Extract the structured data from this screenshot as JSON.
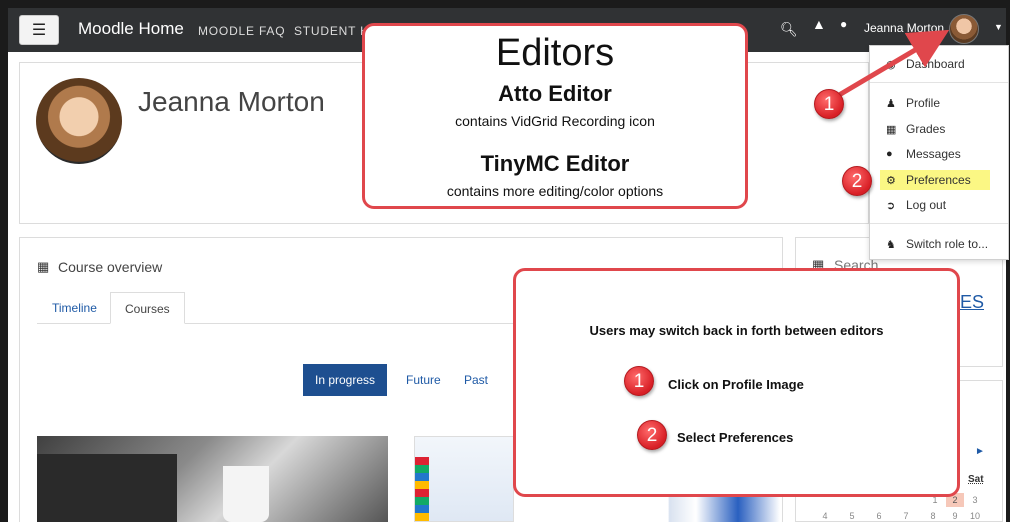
{
  "navbar": {
    "menu_icon": "hamburger-icon",
    "brand": "Moodle Home",
    "links": [
      "MOODLE FAQ",
      "STUDENT H"
    ],
    "user_name": "Jeanna Morton",
    "search_icon": "search-icon",
    "bell_icon": "bell-icon",
    "chat_icon": "chat-icon",
    "caret_icon": "caret-down-icon"
  },
  "profile": {
    "name": "Jeanna Morton"
  },
  "course_overview": {
    "title": "Course overview",
    "tabs": [
      {
        "label": "Timeline"
      },
      {
        "label": "Courses"
      }
    ],
    "filters": [
      {
        "label": "In progress"
      },
      {
        "label": "Future"
      },
      {
        "label": "Past"
      }
    ]
  },
  "side_block": {
    "title": "Search",
    "link_text": "ES"
  },
  "calendar": {
    "next_icon": "arrow-right-icon",
    "day_header": "Sat",
    "row1": [
      "1",
      "2",
      "3"
    ],
    "row2": [
      "4",
      "5",
      "6",
      "7",
      "8",
      "9",
      "10"
    ]
  },
  "user_menu": {
    "items": [
      {
        "label": "Dashboard",
        "icon": "dashboard-icon"
      },
      {
        "label": "Profile",
        "icon": "user-icon"
      },
      {
        "label": "Grades",
        "icon": "table-icon"
      },
      {
        "label": "Messages",
        "icon": "chat-icon"
      },
      {
        "label": "Preferences",
        "icon": "wrench-icon"
      },
      {
        "label": "Log out",
        "icon": "logout-icon"
      },
      {
        "label": "Switch role to...",
        "icon": "user-secret-icon"
      }
    ]
  },
  "callout_editors": {
    "title": "Editors",
    "atto_heading": "Atto Editor",
    "atto_desc": "contains VidGrid Recording icon",
    "tiny_heading": "TinyMC Editor",
    "tiny_desc": "contains more editing/color options"
  },
  "callout_steps": {
    "intro": "Users may switch back in forth between editors",
    "step1_number": "1",
    "step1_text": "Click on Profile Image",
    "step2_number": "2",
    "step2_text": "Select Preferences"
  },
  "markers": {
    "marker1": "1",
    "marker2": "2"
  },
  "colors": {
    "navbar": "#303234",
    "accent": "#1e4f90",
    "callout_border": "#e0474c",
    "highlight": "#fbf784"
  }
}
